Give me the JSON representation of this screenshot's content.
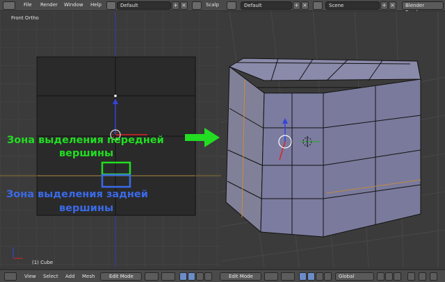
{
  "top_menu": {
    "file": "File",
    "render": "Render",
    "window": "Window",
    "help": "Help",
    "screen_layout": "Default",
    "scene_label": "Scalp",
    "screen_layout_2": "Default",
    "scene": "Scene",
    "render_engine": "Blender Render"
  },
  "viewport": {
    "view_name": "Front Ortho",
    "object_name": "(1) Cube"
  },
  "annotations": {
    "front_vertex_line1": "Зона выделения передней",
    "front_vertex_line2": "вершины",
    "back_vertex_line1": "Зона выделения задней",
    "back_vertex_line2": "вершины",
    "front_color": "#22dd22",
    "back_color": "#3a6ae8"
  },
  "bottom_bar": {
    "view": "View",
    "select": "Select",
    "add": "Add",
    "mesh": "Mesh",
    "mode": "Edit Mode",
    "mode_2": "Edit Mode",
    "orientation": "Global"
  }
}
